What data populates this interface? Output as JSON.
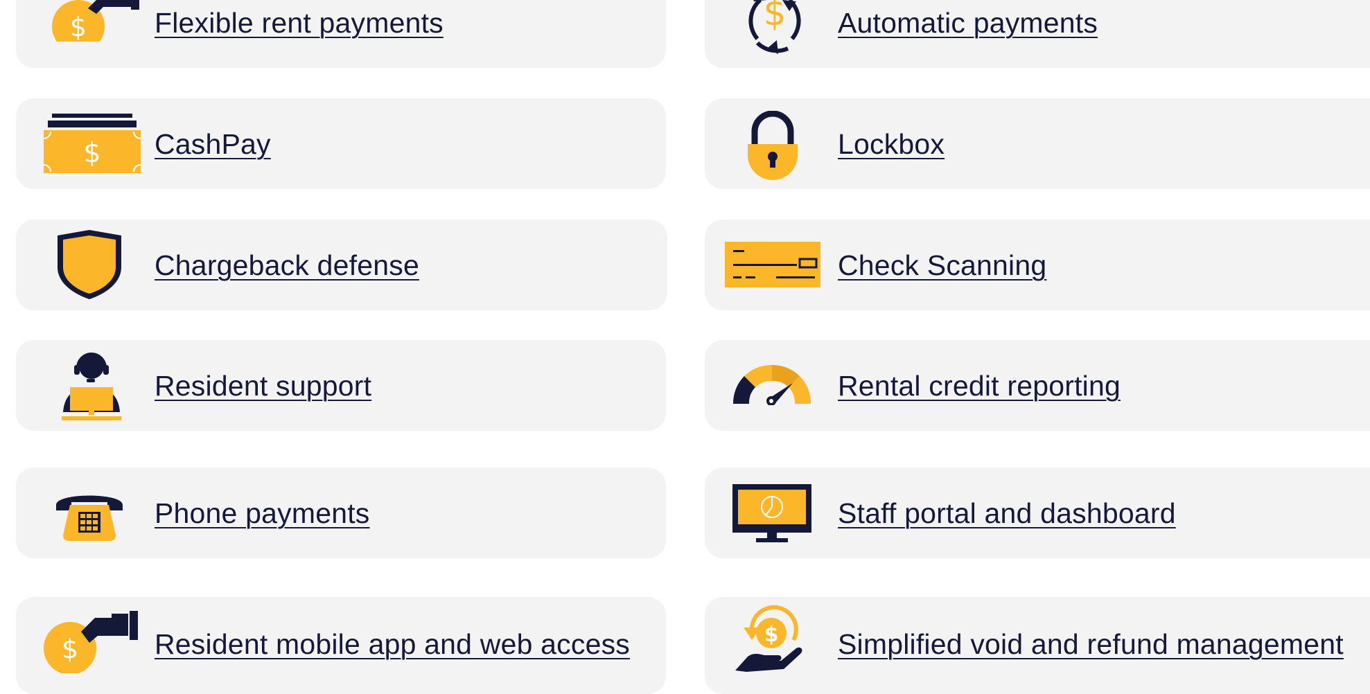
{
  "colors": {
    "card_bg": "#f3f3f3",
    "text": "#14193a",
    "navy": "#14193a",
    "gold": "#fbb62a"
  },
  "features": [
    {
      "label": "Flexible rent payments",
      "icon": "hand-coin-icon"
    },
    {
      "label": "Automatic payments",
      "icon": "recurring-payment-icon"
    },
    {
      "label": "CashPay",
      "icon": "cash-bill-icon"
    },
    {
      "label": "Lockbox",
      "icon": "padlock-icon"
    },
    {
      "label": "Chargeback defense",
      "icon": "shield-icon"
    },
    {
      "label": "Check Scanning",
      "icon": "check-icon"
    },
    {
      "label": "Resident support",
      "icon": "support-agent-icon"
    },
    {
      "label": "Rental credit reporting",
      "icon": "credit-gauge-icon"
    },
    {
      "label": "Phone payments",
      "icon": "telephone-icon"
    },
    {
      "label": "Staff portal and dashboard",
      "icon": "monitor-chart-icon"
    },
    {
      "label": "Resident mobile app and web access",
      "icon": "hand-coin-icon"
    },
    {
      "label": "Simplified void and refund management",
      "icon": "refund-hand-icon"
    }
  ]
}
